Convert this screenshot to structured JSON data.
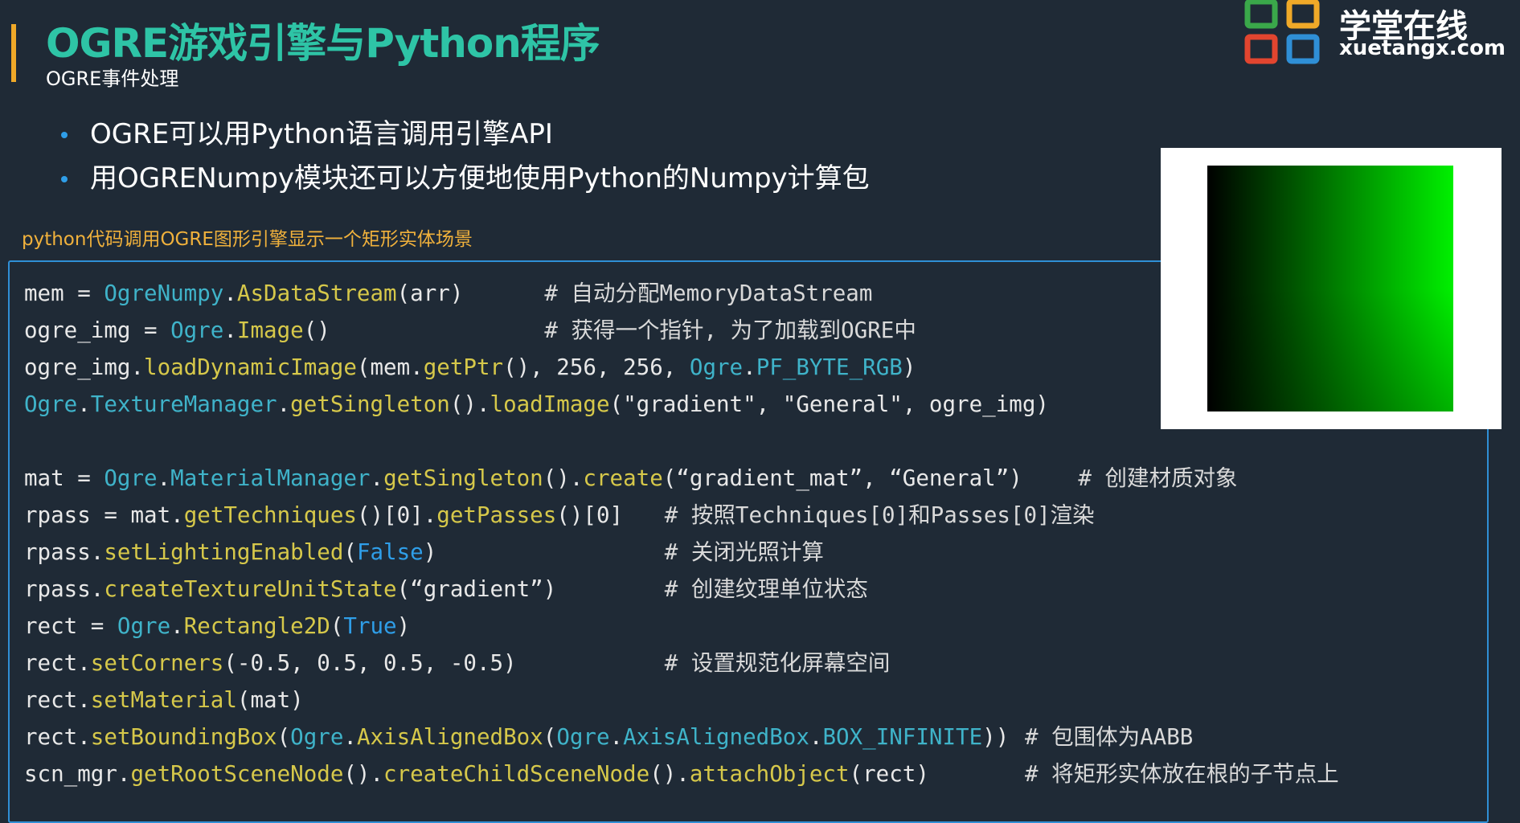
{
  "slide": {
    "title": "OGRE游戏引擎与Python程序",
    "subtitle": "OGRE事件处理"
  },
  "logo": {
    "name_cn": "学堂在线",
    "domain": "xuetangx.com",
    "colors": [
      "#f0a928",
      "#3aa84a",
      "#2f8fd6",
      "#e2452f"
    ]
  },
  "bullets": [
    "OGRE可以用Python语言调用引擎API",
    "用OGRENumpy模块还可以方便地使用Python的Numpy计算包"
  ],
  "caption": "python代码调用OGRE图形引擎显示一个矩形实体场景",
  "preview": {
    "gradient_from": "#000000",
    "gradient_to": "#00f000"
  },
  "colors": {
    "title": "#2ec4a6",
    "accent": "#f0a928",
    "bullet": "#2f9ee8",
    "caption": "#f0b13c",
    "frame": "#2f8fd6"
  },
  "code_lines": [
    {
      "tokens": [
        [
          "id",
          "mem"
        ],
        [
          "p",
          " = "
        ],
        [
          "cls",
          "OgreNumpy"
        ],
        [
          "p",
          "."
        ],
        [
          "fn",
          "AsDataStream"
        ],
        [
          "p",
          "(arr)"
        ]
      ],
      "comment": "# 自动分配MemoryDataStream",
      "comment_col": 39
    },
    {
      "tokens": [
        [
          "id",
          "ogre_img"
        ],
        [
          "p",
          " = "
        ],
        [
          "cls",
          "Ogre"
        ],
        [
          "p",
          "."
        ],
        [
          "fn",
          "Image"
        ],
        [
          "p",
          "()"
        ]
      ],
      "comment": "# 获得一个指针, 为了加载到OGRE中",
      "comment_col": 39
    },
    {
      "tokens": [
        [
          "id",
          "ogre_img"
        ],
        [
          "p",
          "."
        ],
        [
          "fn",
          "loadDynamicImage"
        ],
        [
          "p",
          "(mem."
        ],
        [
          "fn",
          "getPtr"
        ],
        [
          "p",
          "(), "
        ],
        [
          "n",
          "256"
        ],
        [
          "p",
          ", "
        ],
        [
          "n",
          "256"
        ],
        [
          "p",
          ", "
        ],
        [
          "cls",
          "Ogre"
        ],
        [
          "p",
          "."
        ],
        [
          "c",
          "PF_BYTE_RGB"
        ],
        [
          "p",
          ")"
        ]
      ],
      "comment": "",
      "comment_col": 0
    },
    {
      "tokens": [
        [
          "cls",
          "Ogre"
        ],
        [
          "p",
          "."
        ],
        [
          "cls",
          "TextureManager"
        ],
        [
          "p",
          "."
        ],
        [
          "fn",
          "getSingleton"
        ],
        [
          "p",
          "()."
        ],
        [
          "fn",
          "loadImage"
        ],
        [
          "p",
          "("
        ],
        [
          "s",
          "\"gradient\""
        ],
        [
          "p",
          ", "
        ],
        [
          "s",
          "\"General\""
        ],
        [
          "p",
          ", ogre_img)"
        ]
      ],
      "comment": "",
      "comment_col": 0
    },
    {
      "tokens": [],
      "comment": "",
      "comment_col": 0
    },
    {
      "tokens": [
        [
          "id",
          "mat"
        ],
        [
          "p",
          " = "
        ],
        [
          "cls",
          "Ogre"
        ],
        [
          "p",
          "."
        ],
        [
          "cls",
          "MaterialManager"
        ],
        [
          "p",
          "."
        ],
        [
          "fn",
          "getSingleton"
        ],
        [
          "p",
          "()."
        ],
        [
          "fn",
          "create"
        ],
        [
          "p",
          "("
        ],
        [
          "s",
          "“gradient_mat”"
        ],
        [
          "p",
          ", "
        ],
        [
          "s",
          "“General”"
        ],
        [
          "p",
          ")"
        ]
      ],
      "comment": "# 创建材质对象",
      "comment_col": 79
    },
    {
      "tokens": [
        [
          "id",
          "rpass"
        ],
        [
          "p",
          " = mat."
        ],
        [
          "fn",
          "getTechniques"
        ],
        [
          "p",
          "()[0]."
        ],
        [
          "fn",
          "getPasses"
        ],
        [
          "p",
          "()[0]"
        ]
      ],
      "comment": "# 按照Techniques[0]和Passes[0]渲染",
      "comment_col": 48
    },
    {
      "tokens": [
        [
          "id",
          "rpass"
        ],
        [
          "p",
          "."
        ],
        [
          "fn",
          "setLightingEnabled"
        ],
        [
          "p",
          "("
        ],
        [
          "kw",
          "False"
        ],
        [
          "p",
          ")"
        ]
      ],
      "comment": "# 关闭光照计算",
      "comment_col": 48
    },
    {
      "tokens": [
        [
          "id",
          "rpass"
        ],
        [
          "p",
          "."
        ],
        [
          "fn",
          "createTextureUnitState"
        ],
        [
          "p",
          "("
        ],
        [
          "s",
          "“gradient”"
        ],
        [
          "p",
          ")"
        ]
      ],
      "comment": "# 创建纹理单位状态",
      "comment_col": 48
    },
    {
      "tokens": [
        [
          "id",
          "rect"
        ],
        [
          "p",
          " = "
        ],
        [
          "cls",
          "Ogre"
        ],
        [
          "p",
          "."
        ],
        [
          "fn",
          "Rectangle2D"
        ],
        [
          "p",
          "("
        ],
        [
          "kw",
          "True"
        ],
        [
          "p",
          ")"
        ]
      ],
      "comment": "",
      "comment_col": 0
    },
    {
      "tokens": [
        [
          "id",
          "rect"
        ],
        [
          "p",
          "."
        ],
        [
          "fn",
          "setCorners"
        ],
        [
          "p",
          "(-0.5, 0.5, 0.5, -0.5)"
        ]
      ],
      "comment": "# 设置规范化屏幕空间",
      "comment_col": 48
    },
    {
      "tokens": [
        [
          "id",
          "rect"
        ],
        [
          "p",
          "."
        ],
        [
          "fn",
          "setMaterial"
        ],
        [
          "p",
          "(mat)"
        ]
      ],
      "comment": "",
      "comment_col": 0
    },
    {
      "tokens": [
        [
          "id",
          "rect"
        ],
        [
          "p",
          "."
        ],
        [
          "fn",
          "setBoundingBox"
        ],
        [
          "p",
          "("
        ],
        [
          "cls",
          "Ogre"
        ],
        [
          "p",
          "."
        ],
        [
          "fn",
          "AxisAlignedBox"
        ],
        [
          "p",
          "("
        ],
        [
          "cls",
          "Ogre"
        ],
        [
          "p",
          "."
        ],
        [
          "cls",
          "AxisAlignedBox"
        ],
        [
          "p",
          "."
        ],
        [
          "c",
          "BOX_INFINITE"
        ],
        [
          "p",
          "))"
        ]
      ],
      "comment": "# 包围体为AABB",
      "comment_col": 75
    },
    {
      "tokens": [
        [
          "id",
          "scn_mgr"
        ],
        [
          "p",
          "."
        ],
        [
          "fn",
          "getRootSceneNode"
        ],
        [
          "p",
          "()."
        ],
        [
          "fn",
          "createChildSceneNode"
        ],
        [
          "p",
          "()."
        ],
        [
          "fn",
          "attachObject"
        ],
        [
          "p",
          "(rect)"
        ]
      ],
      "comment": "# 将矩形实体放在根的子节点上",
      "comment_col": 75
    }
  ]
}
